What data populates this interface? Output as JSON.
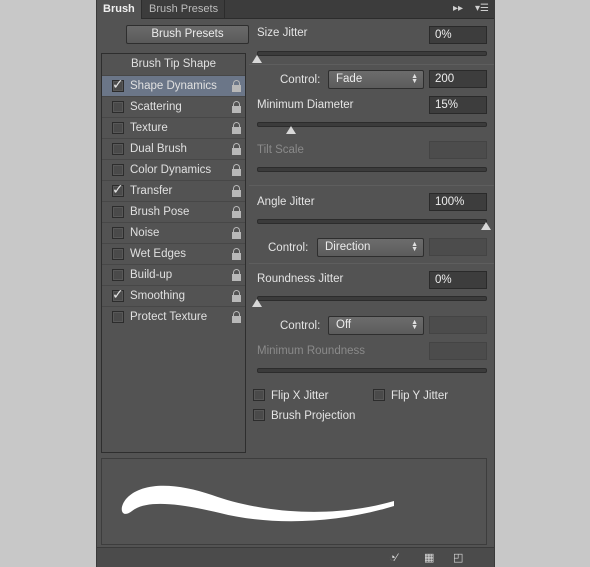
{
  "tabs": [
    {
      "label": "Brush",
      "active": true
    },
    {
      "label": "Brush Presets",
      "active": false
    }
  ],
  "tabbar_icons": [
    "collapse-icon",
    "panel-menu-icon"
  ],
  "presets_button": "Brush Presets",
  "list": {
    "header": "Brush Tip Shape",
    "items": [
      {
        "label": "Shape Dynamics",
        "checked": true,
        "selected": true
      },
      {
        "label": "Scattering",
        "checked": false
      },
      {
        "label": "Texture",
        "checked": false
      },
      {
        "label": "Dual Brush",
        "checked": false
      },
      {
        "label": "Color Dynamics",
        "checked": false
      },
      {
        "label": "Transfer",
        "checked": true
      },
      {
        "label": "Brush Pose",
        "checked": false
      },
      {
        "label": "Noise",
        "checked": false
      },
      {
        "label": "Wet Edges",
        "checked": false
      },
      {
        "label": "Build-up",
        "checked": false
      },
      {
        "label": "Smoothing",
        "checked": true
      },
      {
        "label": "Protect Texture",
        "checked": false
      }
    ]
  },
  "size_jitter": {
    "label": "Size Jitter",
    "value": "0%",
    "slider": 0
  },
  "size_control": {
    "label": "Control:",
    "value": "Fade",
    "steps": "200"
  },
  "min_diameter": {
    "label": "Minimum Diameter",
    "value": "15%",
    "slider": 15
  },
  "tilt_scale": {
    "label": "Tilt Scale",
    "value": ""
  },
  "angle_jitter": {
    "label": "Angle Jitter",
    "value": "100%",
    "slider": 100
  },
  "angle_control": {
    "label": "Control:",
    "value": "Direction"
  },
  "roundness_jitter": {
    "label": "Roundness Jitter",
    "value": "0%",
    "slider": 0
  },
  "roundness_control": {
    "label": "Control:",
    "value": "Off"
  },
  "min_roundness": {
    "label": "Minimum Roundness",
    "value": ""
  },
  "flip_x": {
    "label": "Flip X Jitter",
    "checked": false
  },
  "flip_y": {
    "label": "Flip Y Jitter",
    "checked": false
  },
  "brush_projection": {
    "label": "Brush Projection",
    "checked": false
  },
  "bottom_icons": [
    "toggle-live-tip-icon",
    "grid-icon",
    "new-preset-icon"
  ],
  "colors": {
    "panel": "#535353",
    "selected": "#6b7688",
    "stroke": "#ffffff"
  }
}
